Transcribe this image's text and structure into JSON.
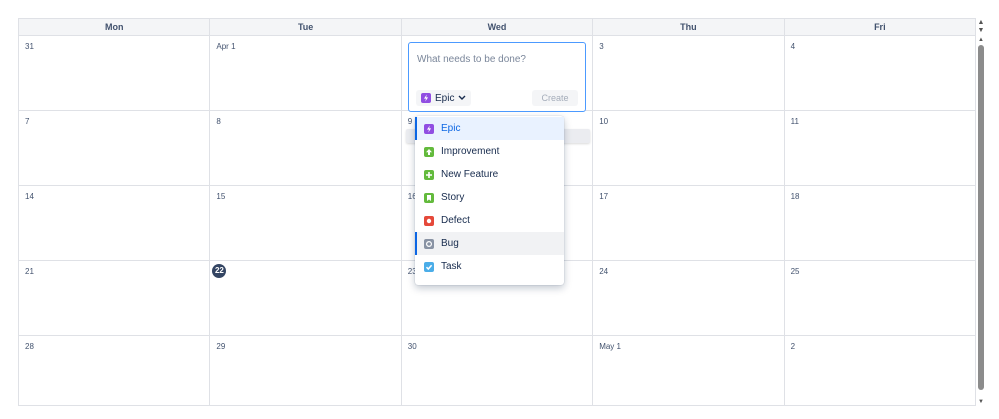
{
  "weekdays": [
    "Mon",
    "Tue",
    "Wed",
    "Thu",
    "Fri"
  ],
  "weeks": [
    [
      "31",
      "Apr 1",
      "",
      "3",
      "4"
    ],
    [
      "7",
      "8",
      "9",
      "10",
      "11"
    ],
    [
      "14",
      "15",
      "16",
      "17",
      "18"
    ],
    [
      "21",
      "22",
      "23",
      "24",
      "25"
    ],
    [
      "28",
      "29",
      "30",
      "May 1",
      "2"
    ]
  ],
  "today": "22",
  "create_card": {
    "placeholder": "What needs to be done?",
    "selected_type": "Epic",
    "create_label": "Create"
  },
  "issue_types": [
    {
      "label": "Epic",
      "icon": "epic-icon",
      "color": "#904ee2",
      "state": "selected"
    },
    {
      "label": "Improvement",
      "icon": "improvement-icon",
      "color": "#63ba3c",
      "state": ""
    },
    {
      "label": "New Feature",
      "icon": "new-feature-icon",
      "color": "#63ba3c",
      "state": ""
    },
    {
      "label": "Story",
      "icon": "story-icon",
      "color": "#63ba3c",
      "state": ""
    },
    {
      "label": "Defect",
      "icon": "defect-icon",
      "color": "#e5493a",
      "state": ""
    },
    {
      "label": "Bug",
      "icon": "bug-icon",
      "color": "#8993a4",
      "state": "hover"
    },
    {
      "label": "Task",
      "icon": "task-icon",
      "color": "#4bade8",
      "state": ""
    }
  ]
}
